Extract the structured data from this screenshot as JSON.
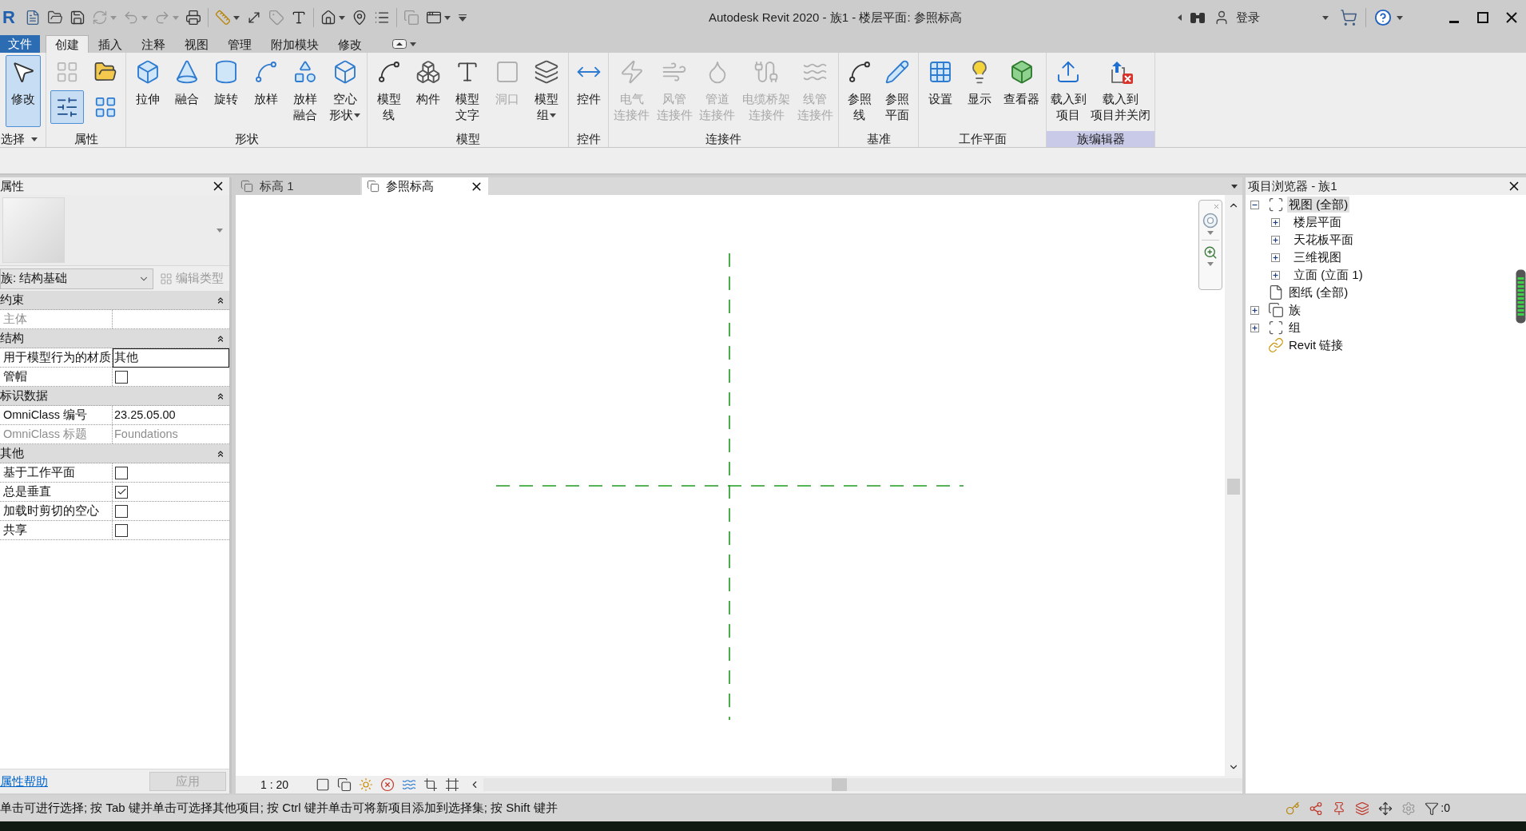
{
  "title_bar": {
    "logo": "R",
    "quick_access": [
      {
        "disabled": false,
        "dropdown": false
      },
      {
        "disabled": false,
        "dropdown": false
      },
      {
        "disabled": false,
        "dropdown": false
      },
      {
        "disabled": true,
        "dropdown": true
      },
      {
        "disabled": true,
        "dropdown": true
      },
      {
        "disabled": true,
        "dropdown": true
      },
      {
        "disabled": false,
        "dropdown": false
      },
      {
        "disabled": false,
        "dropdown": true
      },
      {
        "disabled": false,
        "dropdown": false
      },
      {
        "disabled": true,
        "dropdown": false
      },
      {
        "disabled": false,
        "dropdown": false
      },
      {
        "disabled": false,
        "dropdown": true
      },
      {
        "disabled": false,
        "dropdown": false
      },
      {
        "disabled": false,
        "dropdown": false
      },
      {
        "disabled": true,
        "dropdown": false
      },
      {
        "disabled": false,
        "dropdown": true
      }
    ],
    "title": "Autodesk Revit 2020 - 族1 - 楼层平面: 参照标高",
    "account": {
      "label": "登录"
    }
  },
  "ribbon": {
    "tabs": [
      {
        "label": "文件",
        "kind": "application",
        "selected": false
      },
      {
        "label": "创建",
        "kind": "tab",
        "selected": true
      },
      {
        "label": "插入",
        "kind": "tab",
        "selected": false
      },
      {
        "label": "注释",
        "kind": "tab",
        "selected": false
      },
      {
        "label": "视图",
        "kind": "tab",
        "selected": false
      },
      {
        "label": "管理",
        "kind": "tab",
        "selected": false
      },
      {
        "label": "附加模块",
        "kind": "tab",
        "selected": false
      },
      {
        "label": "修改",
        "kind": "tab",
        "selected": false
      }
    ],
    "panels": [
      {
        "title": "选择",
        "dropdown": true,
        "contextual": false,
        "buttons": [
          {
            "kind": "large",
            "lines": [
              "修改"
            ],
            "selected": true,
            "disabled": false,
            "dropdown": false
          }
        ]
      },
      {
        "title": "属性",
        "dropdown": false,
        "contextual": false,
        "buttons": [
          {
            "kind": "small",
            "selected": false,
            "disabled": true
          },
          {
            "kind": "small",
            "selected": false,
            "disabled": false
          },
          {
            "kind": "small",
            "selected": true,
            "disabled": false
          },
          {
            "kind": "small",
            "selected": false,
            "disabled": false
          }
        ]
      },
      {
        "title": "形状",
        "dropdown": false,
        "contextual": false,
        "buttons": [
          {
            "kind": "large",
            "lines": [
              "拉伸"
            ],
            "selected": false,
            "disabled": false,
            "dropdown": false
          },
          {
            "kind": "large",
            "lines": [
              "融合"
            ],
            "selected": false,
            "disabled": false,
            "dropdown": false
          },
          {
            "kind": "large",
            "lines": [
              "旋转"
            ],
            "selected": false,
            "disabled": false,
            "dropdown": false
          },
          {
            "kind": "large",
            "lines": [
              "放样"
            ],
            "selected": false,
            "disabled": false,
            "dropdown": false
          },
          {
            "kind": "large",
            "lines": [
              "放样",
              "融合"
            ],
            "selected": false,
            "disabled": false,
            "dropdown": false
          },
          {
            "kind": "large",
            "lines": [
              "空心",
              "形状"
            ],
            "selected": false,
            "disabled": false,
            "dropdown": true
          }
        ]
      },
      {
        "title": "模型",
        "dropdown": false,
        "contextual": false,
        "buttons": [
          {
            "kind": "large",
            "lines": [
              "模型",
              "线"
            ],
            "selected": false,
            "disabled": false,
            "dropdown": false
          },
          {
            "kind": "large",
            "lines": [
              "构件"
            ],
            "selected": false,
            "disabled": false,
            "dropdown": false
          },
          {
            "kind": "large",
            "lines": [
              "模型",
              "文字"
            ],
            "selected": false,
            "disabled": false,
            "dropdown": false
          },
          {
            "kind": "large",
            "lines": [
              "洞口"
            ],
            "selected": false,
            "disabled": true,
            "dropdown": false
          },
          {
            "kind": "large",
            "lines": [
              "模型",
              "组"
            ],
            "selected": false,
            "disabled": false,
            "dropdown": true
          }
        ]
      },
      {
        "title": "控件",
        "dropdown": false,
        "contextual": false,
        "buttons": [
          {
            "kind": "large",
            "lines": [
              "控件"
            ],
            "selected": false,
            "disabled": false,
            "dropdown": false
          }
        ]
      },
      {
        "title": "连接件",
        "dropdown": false,
        "contextual": false,
        "buttons": [
          {
            "kind": "large",
            "lines": [
              "电气",
              "连接件"
            ],
            "selected": false,
            "disabled": true,
            "dropdown": false
          },
          {
            "kind": "large",
            "lines": [
              "风管",
              "连接件"
            ],
            "selected": false,
            "disabled": true,
            "dropdown": false
          },
          {
            "kind": "large",
            "lines": [
              "管道",
              "连接件"
            ],
            "selected": false,
            "disabled": true,
            "dropdown": false
          },
          {
            "kind": "large",
            "lines": [
              "电缆桥架",
              "连接件"
            ],
            "selected": false,
            "disabled": true,
            "dropdown": false
          },
          {
            "kind": "large",
            "lines": [
              "线管",
              "连接件"
            ],
            "selected": false,
            "disabled": true,
            "dropdown": false
          }
        ]
      },
      {
        "title": "基准",
        "dropdown": false,
        "contextual": false,
        "buttons": [
          {
            "kind": "large",
            "lines": [
              "参照",
              "线"
            ],
            "selected": false,
            "disabled": false,
            "dropdown": false
          },
          {
            "kind": "large",
            "lines": [
              "参照",
              "平面"
            ],
            "selected": false,
            "disabled": false,
            "dropdown": false
          }
        ]
      },
      {
        "title": "工作平面",
        "dropdown": false,
        "contextual": false,
        "buttons": [
          {
            "kind": "large",
            "lines": [
              "设置"
            ],
            "selected": false,
            "disabled": false,
            "dropdown": false
          },
          {
            "kind": "large",
            "lines": [
              "显示"
            ],
            "selected": false,
            "disabled": false,
            "dropdown": false
          },
          {
            "kind": "large",
            "lines": [
              "查看器"
            ],
            "selected": false,
            "disabled": false,
            "dropdown": false
          }
        ]
      },
      {
        "title": "族编辑器",
        "dropdown": false,
        "contextual": true,
        "buttons": [
          {
            "kind": "large",
            "lines": [
              "载入到",
              "项目"
            ],
            "selected": false,
            "disabled": false,
            "dropdown": false
          },
          {
            "kind": "large",
            "lines": [
              "载入到",
              "项目并关闭"
            ],
            "selected": false,
            "disabled": false,
            "dropdown": false
          }
        ]
      }
    ]
  },
  "properties": {
    "title": "属性",
    "type_selector": {
      "value": "族: 结构基础"
    },
    "edit_type": {
      "label": "编辑类型",
      "disabled": true
    },
    "groups": [
      {
        "title": "约束",
        "expanded": true,
        "rows": [
          {
            "label": "主体",
            "kind": "text",
            "disabled": true,
            "editing": false
          }
        ]
      },
      {
        "title": "结构",
        "expanded": true,
        "rows": [
          {
            "label": "用于模型行为的材质",
            "kind": "text",
            "value": "其他",
            "disabled": false,
            "editing": true
          },
          {
            "label": "管帽",
            "kind": "checkbox",
            "checked": false,
            "disabled": false
          }
        ]
      },
      {
        "title": "标识数据",
        "expanded": true,
        "rows": [
          {
            "label": "OmniClass 编号",
            "kind": "text",
            "value": "23.25.05.00",
            "disabled": false,
            "editing": false
          },
          {
            "label": "OmniClass 标题",
            "kind": "text",
            "value": "Foundations",
            "disabled": true,
            "editing": false
          }
        ]
      },
      {
        "title": "其他",
        "expanded": true,
        "rows": [
          {
            "label": "基于工作平面",
            "kind": "checkbox",
            "checked": false,
            "disabled": false
          },
          {
            "label": "总是垂直",
            "kind": "checkbox",
            "checked": true,
            "disabled": false
          },
          {
            "label": "加载时剪切的空心",
            "kind": "checkbox",
            "checked": false,
            "disabled": false
          },
          {
            "label": "共享",
            "kind": "checkbox",
            "checked": false,
            "disabled": false
          }
        ]
      }
    ],
    "help_link": "属性帮助",
    "apply": {
      "label": "应用",
      "disabled": true
    }
  },
  "view": {
    "tabs": [
      {
        "label": "标高 1",
        "selected": false
      },
      {
        "label": "参照标高",
        "selected": true
      }
    ],
    "scale": "1 : 20"
  },
  "project_browser": {
    "title": "项目浏览器 - 族1",
    "tree": [
      {
        "label": "视图 (全部)",
        "expandable": true,
        "expanded": true,
        "selected": true,
        "children": [
          {
            "label": "楼层平面",
            "expandable": true,
            "expanded": false,
            "selected": false
          },
          {
            "label": "天花板平面",
            "expandable": true,
            "expanded": false,
            "selected": false
          },
          {
            "label": "三维视图",
            "expandable": true,
            "expanded": false,
            "selected": false
          },
          {
            "label": "立面 (立面 1)",
            "expandable": true,
            "expanded": false,
            "selected": false
          }
        ]
      },
      {
        "label": "图纸 (全部)",
        "expandable": false,
        "selected": false
      },
      {
        "label": "族",
        "expandable": true,
        "expanded": false,
        "selected": false
      },
      {
        "label": "组",
        "expandable": true,
        "expanded": false,
        "selected": false
      },
      {
        "label": "Revit 链接",
        "expandable": false,
        "selected": false
      }
    ]
  },
  "status_bar": {
    "message": "单击可进行选择; 按 Tab 键并单击可选择其他项目; 按 Ctrl 键并单击可将新项目添加到选择集; 按 Shift 键并",
    "filter_count": ":0"
  }
}
